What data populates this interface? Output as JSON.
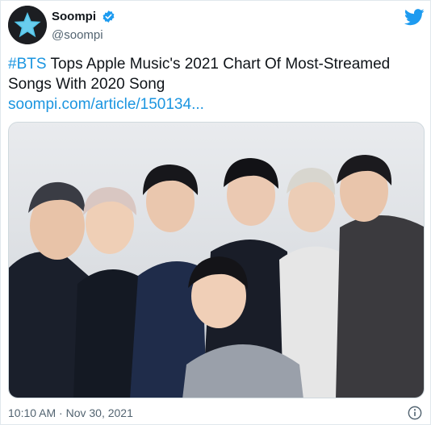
{
  "account": {
    "display_name": "Soompi",
    "handle": "@soompi"
  },
  "tweet": {
    "hashtag": "#BTS",
    "headline": " Tops Apple Music's 2021 Chart Of Most-Streamed Songs With 2020 Song",
    "link": "soompi.com/article/150134...",
    "timestamp": "10:10 AM · Nov 30, 2021"
  },
  "colors": {
    "accent": "#1b95e0",
    "verified": "#1d9bf0",
    "muted": "#536471"
  },
  "icons": {
    "brand": "twitter-bird-icon",
    "verified": "verified-badge-icon",
    "info": "info-icon",
    "avatar": "star-logo-icon"
  }
}
